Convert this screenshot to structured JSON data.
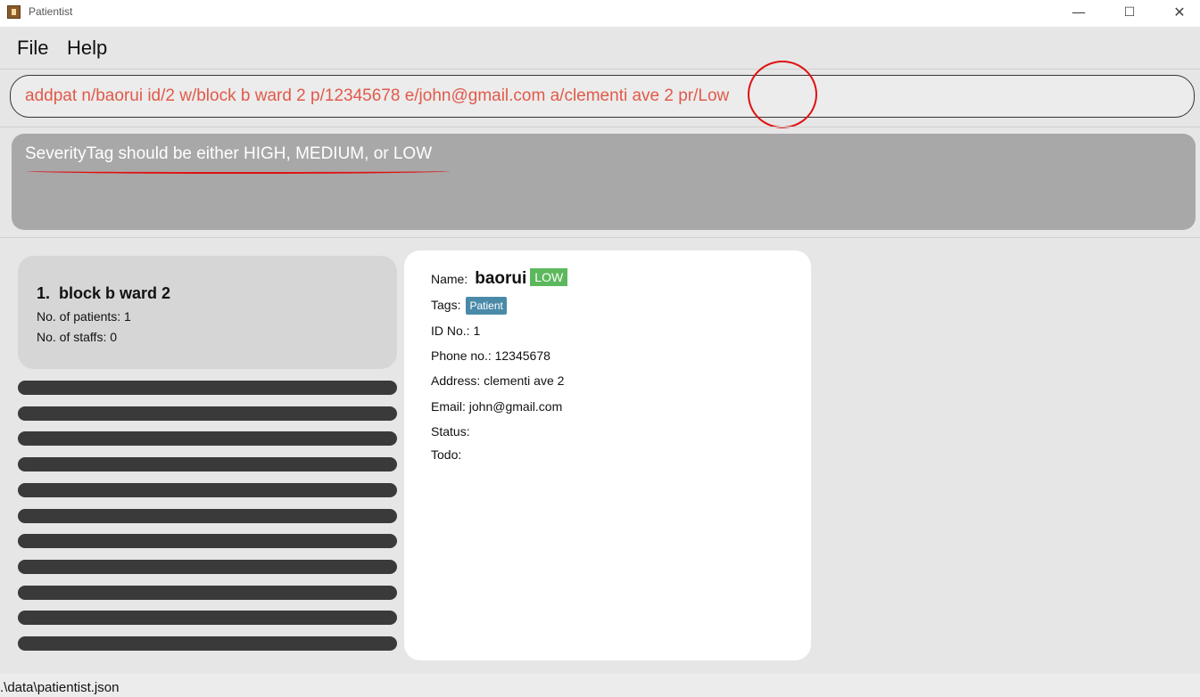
{
  "window": {
    "title": "Patientist",
    "controls": {
      "minimize": "—",
      "maximize": "☐",
      "close": "✕"
    }
  },
  "menu": {
    "items": [
      "File",
      "Help"
    ]
  },
  "command": {
    "value": "addpat n/baorui id/2 w/block b ward 2 p/12345678 e/john@gmail.com a/clementi ave 2 pr/Low",
    "text_color": "#e05a4a"
  },
  "result": {
    "message": "SeverityTag should be either HIGH, MEDIUM, or LOW"
  },
  "ward_list": {
    "selected": {
      "index": "1.",
      "name": "block b ward 2",
      "patients_line": "No. of patients: 1",
      "staffs_line": "No. of staffs: 0"
    }
  },
  "detail": {
    "name_label": "Name:",
    "name_value": "baorui",
    "severity": "LOW",
    "severity_color": "#5cb85c",
    "tags_label": "Tags:",
    "tag": "Patient",
    "tag_color": "#4a8aa8",
    "id_line": "ID No.: 1",
    "phone_line": "Phone no.: 12345678",
    "address_line": "Address: clementi ave 2",
    "email_line": "Email: john@gmail.com",
    "status_line": "Status:",
    "todo_line": "Todo:"
  },
  "status_bar": {
    "path": ".\\data\\patientist.json"
  }
}
